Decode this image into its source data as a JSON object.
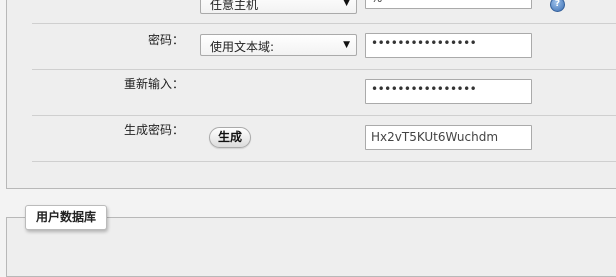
{
  "form": {
    "host_row": {
      "select_value": "任意主机",
      "input_value": "%"
    },
    "password_row": {
      "label": "密码：",
      "select_value": "使用文本域:",
      "input_value": "••••••••••••••••"
    },
    "reenter_row": {
      "label": "重新输入：",
      "input_value": "••••••••••••••••"
    },
    "generate_row": {
      "label": "生成密码：",
      "button_label": "生成",
      "input_value": "Hx2vT5KUt6Wuchdm"
    }
  },
  "section": {
    "legend": "用户数据库"
  },
  "icons": {
    "help": "help-icon",
    "dropdown": "chevron-down-icon"
  }
}
